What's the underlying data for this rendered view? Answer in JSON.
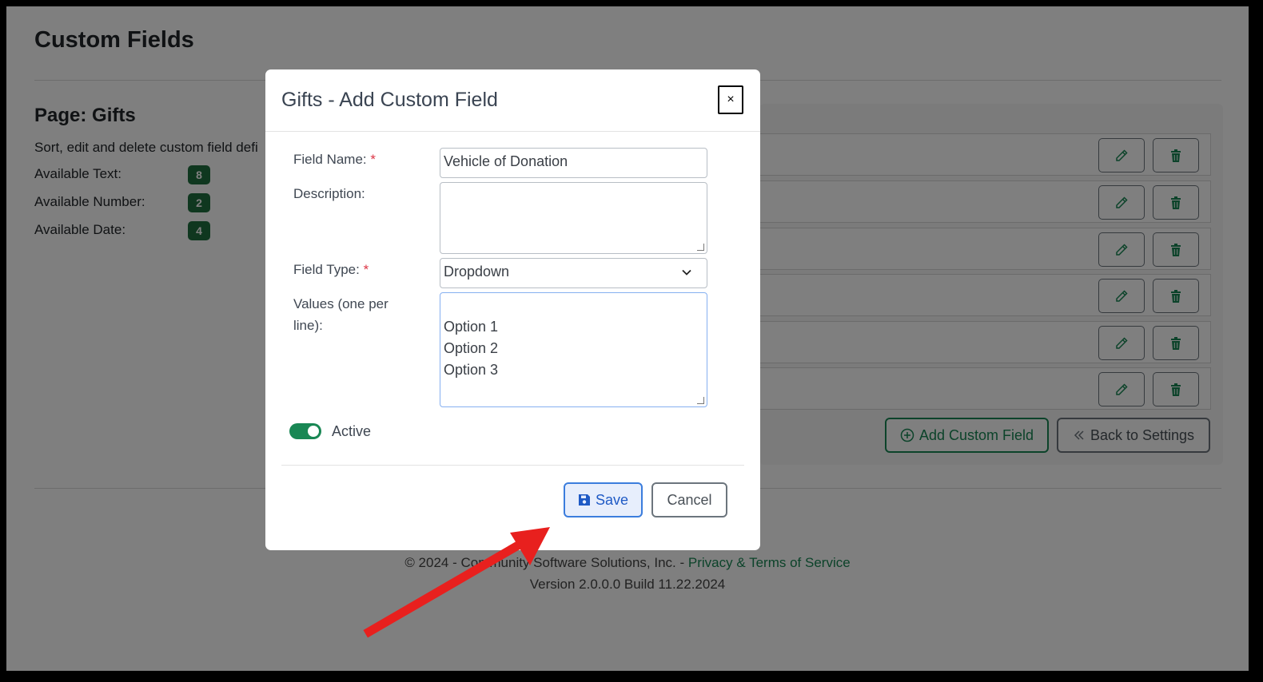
{
  "page": {
    "title": "Custom Fields",
    "section_title": "Page: Gifts",
    "subtitle": "Sort, edit and delete custom field defi",
    "available": [
      {
        "label": "Available Text:",
        "count": "8"
      },
      {
        "label": "Available Number:",
        "count": "2"
      },
      {
        "label": "Available Date:",
        "count": "4"
      }
    ],
    "row_count": 6,
    "add_button": "Add Custom Field",
    "back_button": "Back to Settings"
  },
  "footer": {
    "copyright": "© 2024 - Community Software Solutions, Inc. - ",
    "link": "Privacy & Terms of Service",
    "version": "Version 2.0.0.0 Build 11.22.2024"
  },
  "modal": {
    "title": "Gifts - Add Custom Field",
    "close_label": "×",
    "field_name_label": "Field Name:",
    "field_name_value": "Vehicle of Donation",
    "description_label": "Description:",
    "description_value": "",
    "field_type_label": "Field Type:",
    "field_type_value": "Dropdown",
    "values_label": "Values (one per line):",
    "values_value": "Option 1\nOption 2\nOption 3",
    "required_mark": "*",
    "active_label": "Active",
    "active": true,
    "save_label": "Save",
    "cancel_label": "Cancel"
  },
  "colors": {
    "accent": "#198754",
    "primary": "#3b7ddd",
    "arrow": "#e8201e"
  }
}
